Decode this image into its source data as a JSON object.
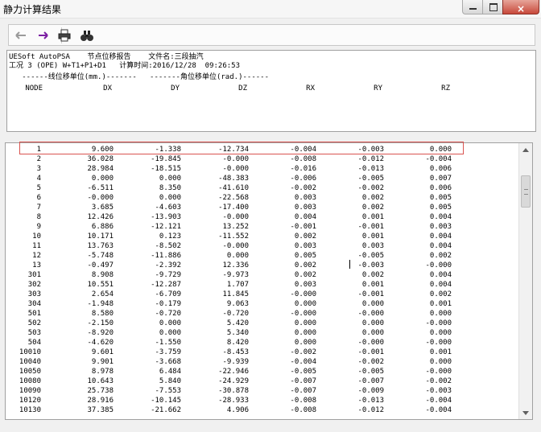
{
  "window": {
    "title": "静力计算结果",
    "close_label": "×"
  },
  "toolbar": {
    "icons": [
      "back-arrow-icon",
      "forward-arrow-icon",
      "print-icon",
      "binoculars-icon"
    ]
  },
  "report": {
    "line1": "UESoft AutoPSA    节点位移报告    文件名:三段抽汽",
    "line2": "工况 3 (OPE) W+T1+P1+D1   计算时间:2016/12/28  09:26:53",
    "line3": "   ------线位移单位(mm.)-------   -------角位移单位(rad.)------",
    "columns": [
      "NODE",
      "DX",
      "DY",
      "DZ",
      "RX",
      "RY",
      "RZ"
    ]
  },
  "rows": [
    [
      "1",
      "9.600",
      "-1.338",
      "-12.734",
      "-0.004",
      "-0.003",
      "0.000"
    ],
    [
      "2",
      "36.028",
      "-19.845",
      "-0.000",
      "-0.008",
      "-0.012",
      "-0.004"
    ],
    [
      "3",
      "28.984",
      "-18.515",
      "-0.000",
      "-0.016",
      "-0.013",
      "0.006"
    ],
    [
      "4",
      "0.000",
      "0.000",
      "-48.383",
      "-0.006",
      "-0.005",
      "0.007"
    ],
    [
      "5",
      "-6.511",
      "8.350",
      "-41.610",
      "-0.002",
      "-0.002",
      "0.006"
    ],
    [
      "6",
      "-0.000",
      "0.000",
      "-22.568",
      "0.003",
      "0.002",
      "0.005"
    ],
    [
      "7",
      "3.685",
      "-4.603",
      "-17.400",
      "0.003",
      "0.002",
      "0.005"
    ],
    [
      "8",
      "12.426",
      "-13.903",
      "-0.000",
      "0.004",
      "0.001",
      "0.004"
    ],
    [
      "9",
      "6.886",
      "-12.121",
      "13.252",
      "-0.001",
      "-0.001",
      "0.003"
    ],
    [
      "10",
      "10.171",
      "0.123",
      "-11.552",
      "0.002",
      "0.001",
      "0.004"
    ],
    [
      "11",
      "13.763",
      "-8.502",
      "-0.000",
      "0.003",
      "0.003",
      "0.004"
    ],
    [
      "12",
      "-5.748",
      "-11.886",
      "0.000",
      "0.005",
      "-0.005",
      "0.002"
    ],
    [
      "13",
      "-0.497",
      "-2.392",
      "12.336",
      "0.002",
      "-0.003",
      "-0.000"
    ],
    [
      "301",
      "8.908",
      "-9.729",
      "-9.973",
      "0.002",
      "0.002",
      "0.004"
    ],
    [
      "302",
      "10.551",
      "-12.287",
      "1.707",
      "0.003",
      "0.001",
      "0.004"
    ],
    [
      "303",
      "2.654",
      "-6.709",
      "11.845",
      "-0.000",
      "-0.001",
      "0.002"
    ],
    [
      "304",
      "-1.948",
      "-0.179",
      "9.063",
      "0.000",
      "0.000",
      "0.001"
    ],
    [
      "501",
      "8.580",
      "-0.720",
      "-0.720",
      "-0.000",
      "-0.000",
      "0.000"
    ],
    [
      "502",
      "-2.150",
      "0.000",
      "5.420",
      "0.000",
      "0.000",
      "-0.000"
    ],
    [
      "503",
      "-8.920",
      "0.000",
      "5.340",
      "0.000",
      "0.000",
      "0.000"
    ],
    [
      "504",
      "-4.620",
      "-1.550",
      "8.420",
      "0.000",
      "-0.000",
      "-0.000"
    ],
    [
      "10010",
      "9.601",
      "-3.759",
      "-8.453",
      "-0.002",
      "-0.001",
      "0.001"
    ],
    [
      "10040",
      "9.901",
      "-3.668",
      "-9.939",
      "-0.004",
      "-0.002",
      "0.000"
    ],
    [
      "10050",
      "8.978",
      "6.484",
      "-22.946",
      "-0.005",
      "-0.005",
      "-0.000"
    ],
    [
      "10080",
      "10.643",
      "5.840",
      "-24.929",
      "-0.007",
      "-0.007",
      "-0.002"
    ],
    [
      "10090",
      "25.738",
      "-7.553",
      "-30.878",
      "-0.007",
      "-0.009",
      "-0.003"
    ],
    [
      "10120",
      "28.916",
      "-10.145",
      "-28.933",
      "-0.008",
      "-0.013",
      "-0.004"
    ],
    [
      "10130",
      "37.385",
      "-21.662",
      "4.906",
      "-0.008",
      "-0.012",
      "-0.004"
    ]
  ]
}
